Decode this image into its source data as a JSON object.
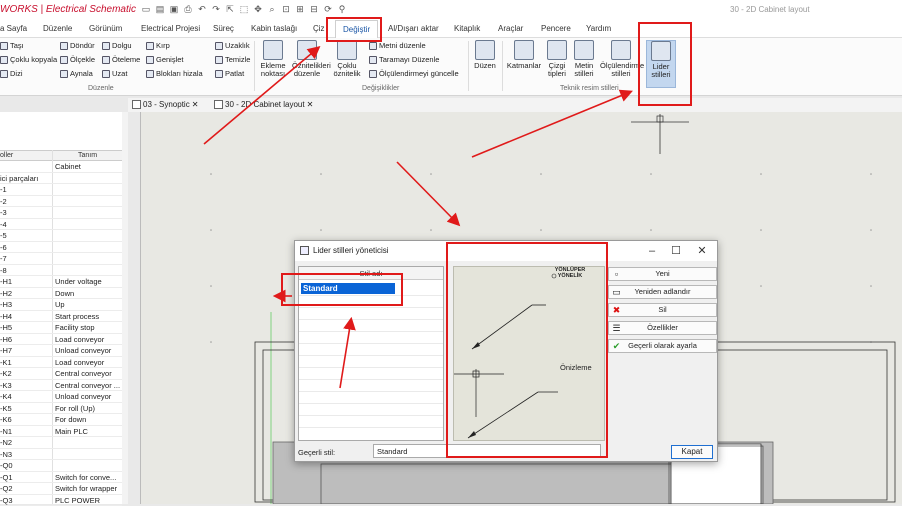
{
  "app": {
    "title": "WORKS | Electrical Schematic",
    "doc_title": "30 - 2D Cabinet layout"
  },
  "tabs": [
    "a Sayfa",
    "Düzenle",
    "Görünüm",
    "Electrical Projesi",
    "Süreç",
    "Kabin taslağı",
    "Çiz",
    "Değiştir",
    "Al/Dışarı aktar",
    "Kitaplık",
    "Araçlar",
    "Pencere",
    "Yardım"
  ],
  "ribbon": {
    "duzenle_col1": [
      "Taşı",
      "Çoklu kopyala",
      "Dizi"
    ],
    "duzenle_col2": [
      "Döndür",
      "Ölçekle",
      "Aynala"
    ],
    "duzenle_col3": [
      "Dolgu",
      "Öteleme",
      "Uzat"
    ],
    "duzenle_col4": [
      "Kırp",
      "Genişlet",
      "Blokları hizala"
    ],
    "duzenle_col5": [
      "Uzaklık",
      "Temizle",
      "Patlat"
    ],
    "group_duzenle": "Düzenle",
    "big_ekleme": "Ekleme noktası",
    "big_oznitelik": "Öznitelikleri düzenle",
    "big_coklu": "Çoklu öznitelik",
    "deg_list": [
      "Metni düzenle",
      "Taramayı Düzenle",
      "Ölçülendirmeyi güncelle"
    ],
    "group_degisiklikler": "Değişiklikler",
    "big_duzen": "Düzen",
    "big_katmanlar": "Katmanlar",
    "big_cizgi": "Çizgi tipleri",
    "big_metin": "Metin stilleri",
    "big_olculendirme": "Ölçülendirme stilleri",
    "big_lider": "Lider stilleri",
    "group_teknik": "Teknik resim stilleri"
  },
  "doc_tabs": [
    "03 - Synoptic",
    "30 - 2D Cabinet layout"
  ],
  "left_panel": {
    "col1": "oller",
    "col2": "Tanım",
    "rows": [
      [
        "",
        "Cabinet"
      ],
      [
        "ici parçaları",
        ""
      ],
      [
        "-1",
        ""
      ],
      [
        "-2",
        ""
      ],
      [
        "-3",
        ""
      ],
      [
        "-4",
        ""
      ],
      [
        "-5",
        ""
      ],
      [
        "-6",
        ""
      ],
      [
        "-7",
        ""
      ],
      [
        "-8",
        ""
      ],
      [
        "-H1",
        "Under voltage"
      ],
      [
        "-H2",
        "Down"
      ],
      [
        "-H3",
        "Up"
      ],
      [
        "-H4",
        "Start process"
      ],
      [
        "-H5",
        "Facility stop"
      ],
      [
        "-H6",
        "Load conveyor"
      ],
      [
        "-H7",
        "Unload conveyor"
      ],
      [
        "-K1",
        "Load conveyor"
      ],
      [
        "-K2",
        "Central conveyor"
      ],
      [
        "-K3",
        "Central conveyor ..."
      ],
      [
        "-K4",
        "Unload conveyor"
      ],
      [
        "-K5",
        "For roll (Up)"
      ],
      [
        "-K6",
        "For down"
      ],
      [
        "-N1",
        "Main PLC"
      ],
      [
        "-N2",
        ""
      ],
      [
        "-N3",
        ""
      ],
      [
        "-Q0",
        ""
      ],
      [
        "-Q1",
        "Switch for conve..."
      ],
      [
        "-Q2",
        "Switch for wrapper"
      ],
      [
        "-Q3",
        "PLC POWER"
      ]
    ]
  },
  "dialog": {
    "title": "Lider stilleri yöneticisi",
    "list_header": "Stil adı",
    "selected_style": "Standard",
    "preview_top_label": "YÖNLÜPER YÖNELİK",
    "preview_label": "Önizleme",
    "buttons": [
      "Yeni",
      "Yeniden adlandır",
      "Sil",
      "Özellikler",
      "Geçerli olarak ayarla"
    ],
    "current_label": "Geçerli stil:",
    "current_value": "Standard",
    "close_label": "Kapat"
  }
}
